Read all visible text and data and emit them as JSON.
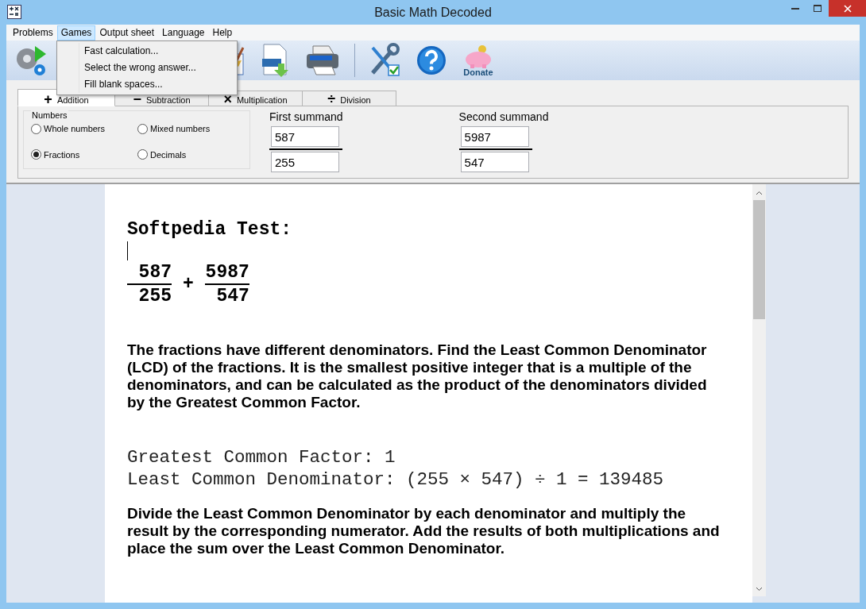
{
  "window": {
    "title": "Basic Math Decoded"
  },
  "menu": [
    {
      "label": "Problems",
      "selected": false
    },
    {
      "label": "Games",
      "selected": true
    },
    {
      "label": "Output sheet",
      "selected": false
    },
    {
      "label": "Language",
      "selected": false
    },
    {
      "label": "Help",
      "selected": false
    }
  ],
  "dropdown": [
    "Fast calculation...",
    "Select the wrong answer...",
    "Fill blank spaces..."
  ],
  "toolbar": [
    {
      "kind": "run"
    },
    {
      "kind": "clear"
    },
    {
      "kind": "rtf"
    },
    {
      "kind": "print"
    },
    {
      "kind": "settings"
    },
    {
      "kind": "help"
    },
    {
      "kind": "donate",
      "label": "Donate"
    }
  ],
  "tabs": [
    {
      "symbol": "+",
      "label": "Addition",
      "selected": true
    },
    {
      "symbol": "−",
      "label": "Subtraction",
      "selected": false
    },
    {
      "symbol": "×",
      "label": "Multiplication",
      "selected": false
    },
    {
      "symbol": "÷",
      "label": "Division",
      "selected": false
    }
  ],
  "numbers": {
    "title": "Numbers",
    "options": [
      {
        "label": "Whole numbers",
        "selected": false
      },
      {
        "label": "Mixed numbers",
        "selected": false
      },
      {
        "label": "Fractions",
        "selected": true
      },
      {
        "label": "Decimals",
        "selected": false
      }
    ]
  },
  "summands": [
    {
      "label": "First summand",
      "numerator": "587",
      "denominator": "255"
    },
    {
      "label": "Second summand",
      "numerator": "5987",
      "denominator": "547"
    }
  ],
  "document": {
    "heading": "Softpedia Test:",
    "fractions": [
      {
        "numerator": "587",
        "denominator": "255"
      },
      {
        "numerator": "5987",
        "denominator": "547"
      }
    ],
    "operator": "+",
    "paragraph_1": "The fractions have different denominators. Find the Least Common Denominator (LCD) of the fractions. It is the smallest positive integer that is a multiple of the denominators, and can be calculated as the product of the denominators divided by the Greatest Common Factor.",
    "lines": [
      "Greatest Common Factor: 1",
      "Least Common Denominator: (255 × 547) ÷ 1 = 139485"
    ],
    "paragraph_2": "Divide the Least Common Denominator by each denominator and multiply the result by the corresponding numerator. Add the results of both multiplications and place the sum over the Least Common Denominator."
  }
}
